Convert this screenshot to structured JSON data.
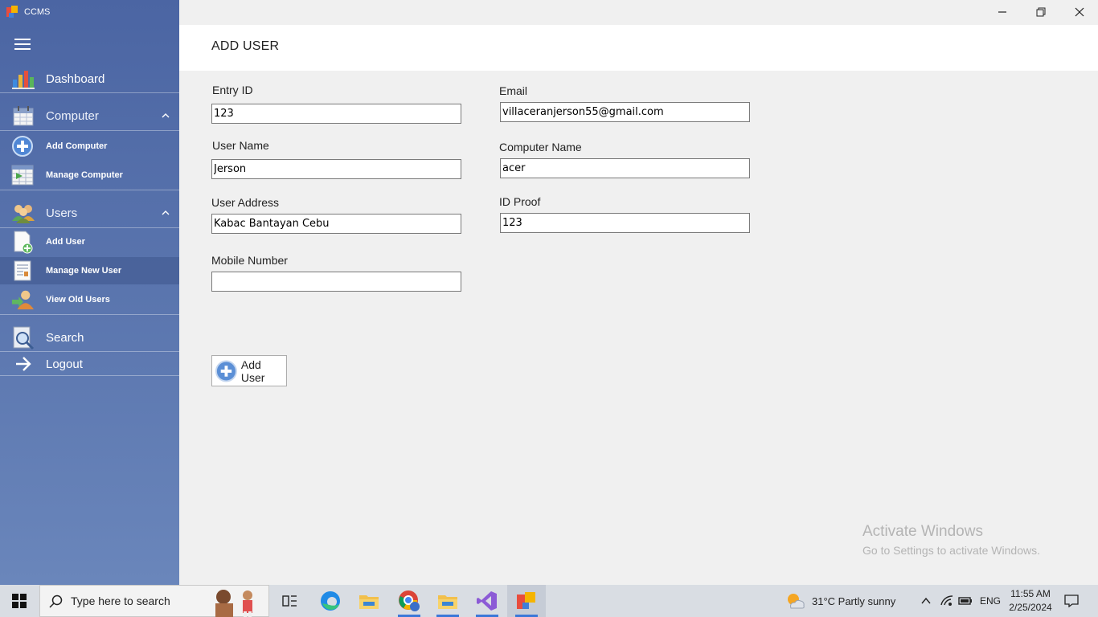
{
  "app": {
    "title": "CCMS"
  },
  "sidebar": {
    "dashboard": "Dashboard",
    "computer": "Computer",
    "add_computer": "Add Computer",
    "manage_computer": "Manage Computer",
    "users": "Users",
    "add_user": "Add User",
    "manage_new_user": "Manage New User",
    "view_old_users": "View Old Users",
    "search": "Search",
    "logout": "Logout"
  },
  "page": {
    "title": "ADD USER"
  },
  "form": {
    "entry_id": {
      "label": "Entry ID",
      "value": "123"
    },
    "user_name": {
      "label": "User Name",
      "value": "Jerson"
    },
    "user_address": {
      "label": "User Address",
      "value": "Kabac Bantayan Cebu"
    },
    "mobile_number": {
      "label": "Mobile Number",
      "value": ""
    },
    "email": {
      "label": "Email",
      "value": "villaceranjerson55@gmail.com"
    },
    "computer_name": {
      "label": "Computer Name",
      "value": "acer"
    },
    "id_proof": {
      "label": "ID Proof",
      "value": "123"
    },
    "submit_label": "Add User"
  },
  "watermark": {
    "line1": "Activate Windows",
    "line2": "Go to Settings to activate Windows."
  },
  "taskbar": {
    "search_placeholder": "Type here to search",
    "weather": "31°C  Partly sunny",
    "language": "ENG",
    "time": "11:55 AM",
    "date": "2/25/2024"
  },
  "colors": {
    "sidebar": "#5a75ae",
    "header": "#ffffff",
    "content": "#f0f0f0",
    "taskbar": "#d9dde3"
  }
}
